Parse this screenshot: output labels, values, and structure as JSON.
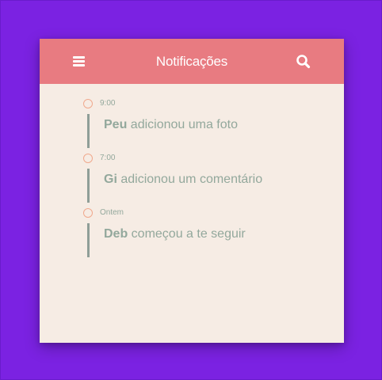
{
  "header": {
    "title": "Notificações",
    "menu_icon": "hamburger-menu-icon",
    "search_icon": "search-icon"
  },
  "colors": {
    "page_background": "#7b22e2",
    "header": "#e87b81",
    "card_background": "#f6ece4",
    "text": "#93a89c",
    "timeline_dot": "#f0a98d",
    "timeline_line": "#8f9e97"
  },
  "notifications": [
    {
      "time": "9:00",
      "user": "Peu",
      "action": " adicionou uma foto"
    },
    {
      "time": "7:00",
      "user": "Gi",
      "action": " adicionou um comentário"
    },
    {
      "time": "Ontem",
      "user": "Deb",
      "action": " começou a te seguir"
    }
  ]
}
